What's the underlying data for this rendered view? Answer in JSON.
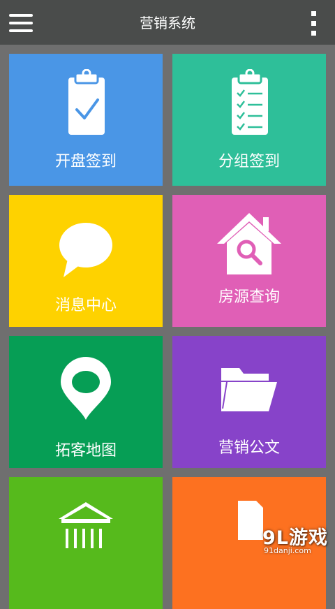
{
  "header": {
    "title": "营销系统",
    "menu_icon": "hamburger-menu-icon",
    "more_icon": "vertical-dots-icon",
    "background": "#4a4c4b"
  },
  "tiles": [
    {
      "label": "开盘签到",
      "icon": "clipboard-check-icon",
      "color": "#4a96e6"
    },
    {
      "label": "分组签到",
      "icon": "clipboard-list-icon",
      "color": "#2ebf99"
    },
    {
      "label": "消息中心",
      "icon": "speech-bubble-icon",
      "color": "#fed200"
    },
    {
      "label": "房源查询",
      "icon": "house-search-icon",
      "color": "#e05fb6"
    },
    {
      "label": "拓客地图",
      "icon": "map-pin-icon",
      "color": "#069e55"
    },
    {
      "label": "营销公文",
      "icon": "folder-icon",
      "color": "#8743c9"
    },
    {
      "label": "",
      "icon": "building-columns-icon",
      "color": "#56ba1c"
    },
    {
      "label": "",
      "icon": "document-icon",
      "color": "#fd7120"
    }
  ],
  "watermark": {
    "brand": "9L游戏",
    "domain": "91danji.com"
  }
}
